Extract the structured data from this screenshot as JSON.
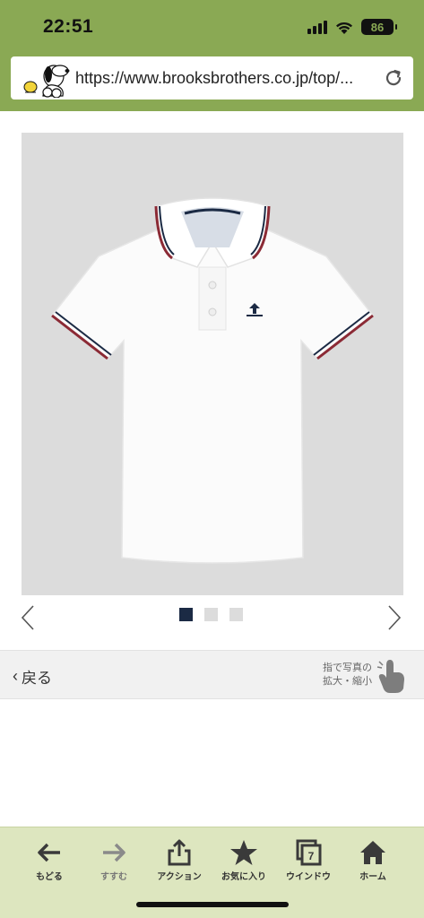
{
  "status_bar": {
    "time": "22:51",
    "battery": "86",
    "icons": [
      "cellular-signal-icon",
      "wifi-icon",
      "battery-icon"
    ]
  },
  "browser": {
    "url": "https://www.brooksbrothers.co.jp/top/...",
    "favicon": "snoopy-favicon",
    "reload_icon": "reload-icon"
  },
  "product": {
    "image_alt": "white polo shirt with tipped collar",
    "carousel": {
      "total": 3,
      "active": 1
    }
  },
  "nav_strip": {
    "back_label": "戻る",
    "zoom_hint_line1": "指で写真の",
    "zoom_hint_line2": "拡大・縮小"
  },
  "toolbar": {
    "items": [
      {
        "label": "もどる",
        "icon": "back-arrow-icon"
      },
      {
        "label": "すすむ",
        "icon": "forward-arrow-icon"
      },
      {
        "label": "アクション",
        "icon": "share-icon"
      },
      {
        "label": "お気に入り",
        "icon": "star-icon"
      },
      {
        "label": "ウインドウ",
        "icon": "windows-icon",
        "badge": "7"
      },
      {
        "label": "ホーム",
        "icon": "home-icon"
      }
    ]
  },
  "colors": {
    "header": "#8aa954",
    "toolbar": "#dde6bf",
    "active_dot": "#1b2a44",
    "image_bg": "#dcdcdc"
  }
}
